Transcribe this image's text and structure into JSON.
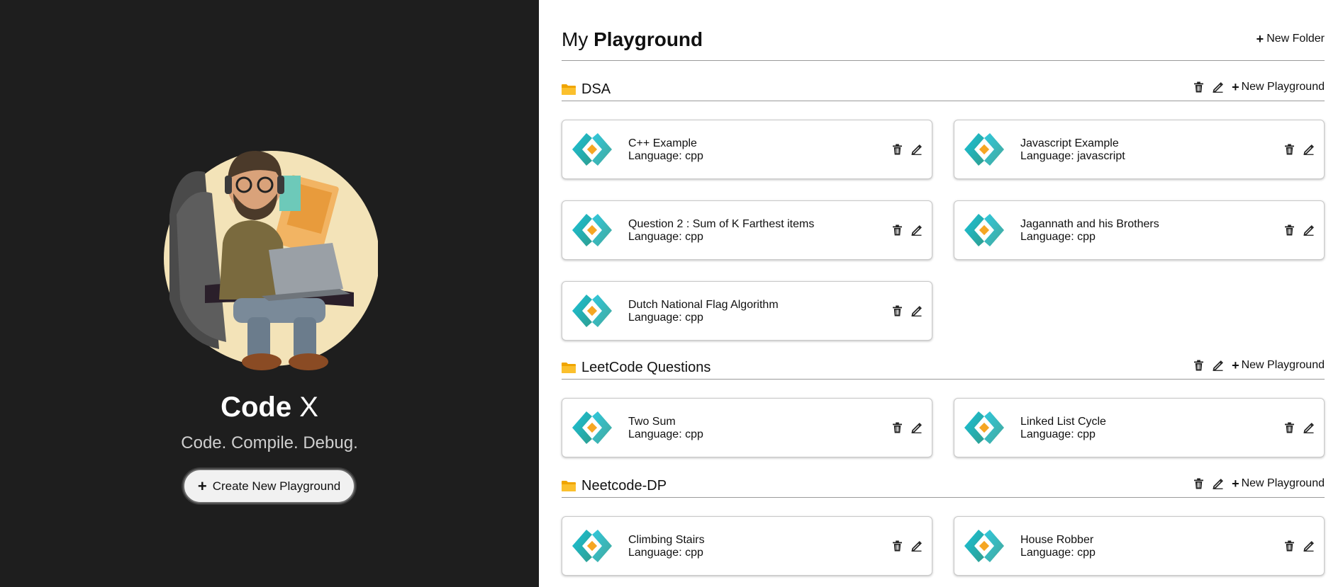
{
  "sidebar": {
    "brand_main": "Code",
    "brand_x": "X",
    "tagline": "Code. Compile. Debug.",
    "create_button_label": "Create New Playground"
  },
  "header": {
    "title_light": "My",
    "title_bold": "Playground",
    "new_folder_label": "New Folder"
  },
  "labels": {
    "new_playground": "New Playground"
  },
  "icons": {
    "folder": "folder-icon",
    "delete": "trash-icon",
    "edit": "pencil-icon",
    "add": "plus-icon",
    "playground": "code-brackets-logo-icon"
  },
  "colors": {
    "sidebar_bg": "#1e1e1e",
    "folder_yellow": "#f5b81a",
    "logo_teal": "#1ab3c8",
    "logo_orange": "#f5a623"
  },
  "folders": [
    {
      "name": "DSA",
      "cards": [
        {
          "title": "C++ Example",
          "language": "Language: cpp"
        },
        {
          "title": "Javascript Example",
          "language": "Language: javascript"
        },
        {
          "title": "Question 2 : Sum of K Farthest items",
          "language": "Language: cpp"
        },
        {
          "title": "Jagannath and his Brothers",
          "language": "Language: cpp"
        },
        {
          "title": "Dutch National Flag Algorithm",
          "language": "Language: cpp"
        }
      ]
    },
    {
      "name": "LeetCode Questions",
      "cards": [
        {
          "title": "Two Sum",
          "language": "Language: cpp"
        },
        {
          "title": "Linked List Cycle",
          "language": "Language: cpp"
        }
      ]
    },
    {
      "name": "Neetcode-DP",
      "cards": [
        {
          "title": "Climbing Stairs",
          "language": "Language: cpp"
        },
        {
          "title": "House Robber",
          "language": "Language: cpp"
        }
      ]
    }
  ]
}
